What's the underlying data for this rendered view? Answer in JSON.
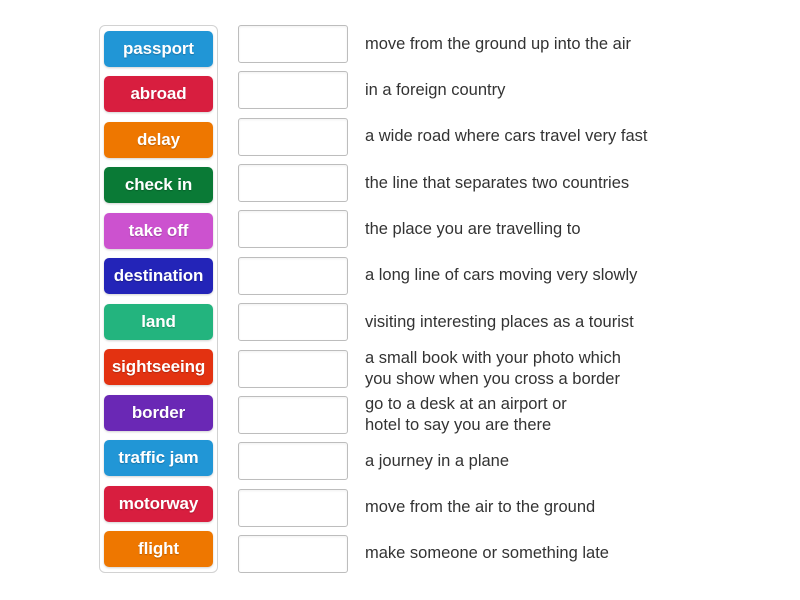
{
  "activity": {
    "type": "match-up",
    "tile_text_color": "#ffffff",
    "drop_box_border_color": "#bdbdbd",
    "panel_border_color": "#d2d2d2",
    "background_color": "#ffffff",
    "definition_text_color": "#333333"
  },
  "tiles": [
    {
      "label": "passport",
      "color": "#2196d6"
    },
    {
      "label": "abroad",
      "color": "#d81e3f"
    },
    {
      "label": "delay",
      "color": "#ee7700"
    },
    {
      "label": "check in",
      "color": "#0a7a36"
    },
    {
      "label": "take off",
      "color": "#cc52cf"
    },
    {
      "label": "destination",
      "color": "#2324b8"
    },
    {
      "label": "land",
      "color": "#23b47e"
    },
    {
      "label": "sightseeing",
      "color": "#e33211"
    },
    {
      "label": "border",
      "color": "#6a28b5"
    },
    {
      "label": "traffic jam",
      "color": "#2196d6"
    },
    {
      "label": "motorway",
      "color": "#d81e3f"
    },
    {
      "label": "flight",
      "color": "#ee7700"
    }
  ],
  "definitions": [
    {
      "answer": "",
      "text": "move from the ground up into the air"
    },
    {
      "answer": "",
      "text": "in a foreign country"
    },
    {
      "answer": "",
      "text": "a wide road where cars travel very fast"
    },
    {
      "answer": "",
      "text": "the line that separates two countries"
    },
    {
      "answer": "",
      "text": "the place you are travelling to"
    },
    {
      "answer": "",
      "text": "a long line of cars moving very slowly"
    },
    {
      "answer": "",
      "text": "visiting interesting places as a tourist"
    },
    {
      "answer": "",
      "text": "a small book with your photo which\nyou show when you cross a border"
    },
    {
      "answer": "",
      "text": "go to a desk at an airport or\nhotel to say you are there"
    },
    {
      "answer": "",
      "text": "a journey in a plane"
    },
    {
      "answer": "",
      "text": "move from the air to the ground"
    },
    {
      "answer": "",
      "text": "make someone or something late"
    }
  ]
}
